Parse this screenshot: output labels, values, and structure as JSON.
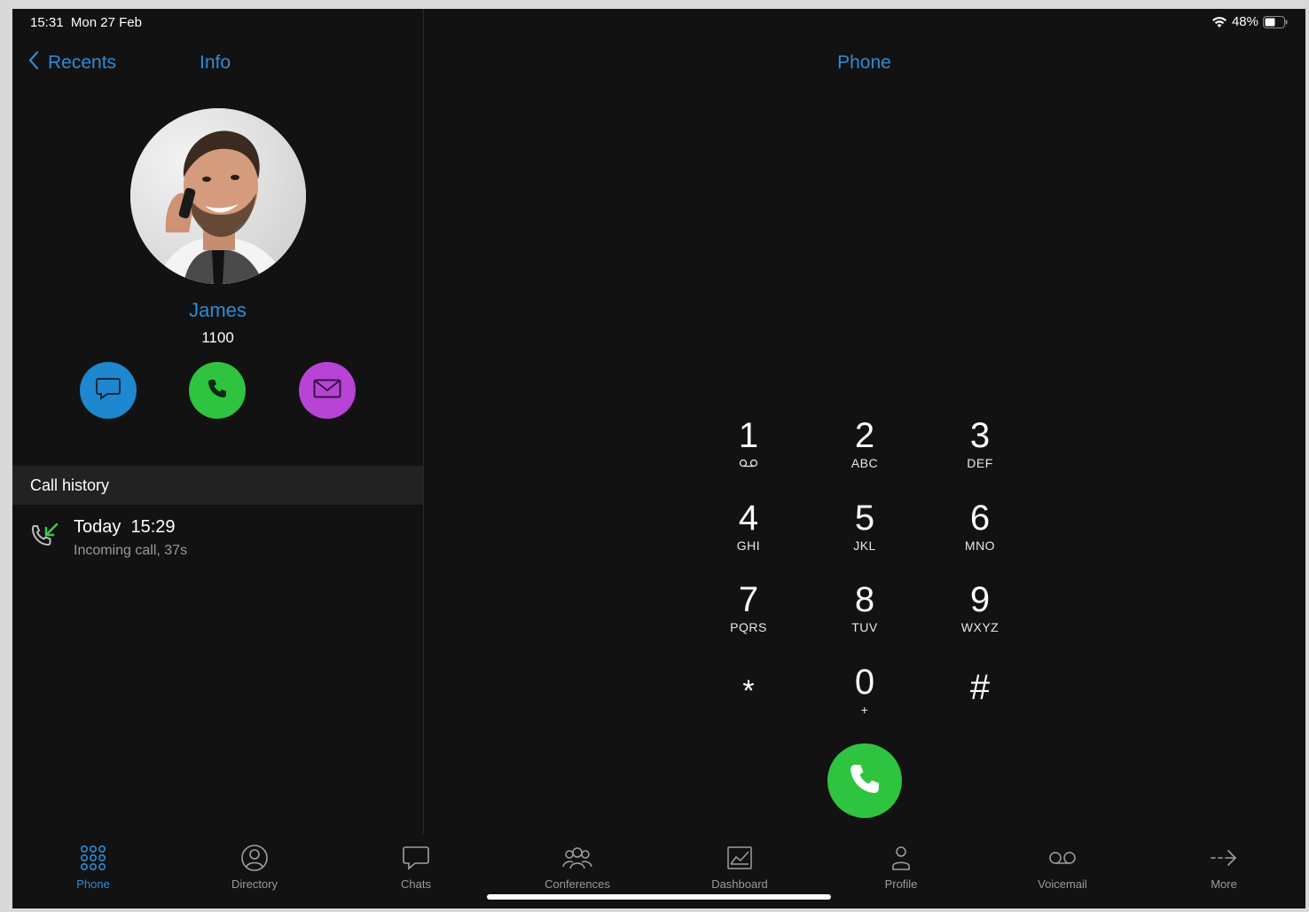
{
  "status_bar": {
    "time": "15:31",
    "date": "Mon 27 Feb",
    "battery": "48%"
  },
  "left_pane": {
    "back_label": "Recents",
    "title": "Info",
    "contact": {
      "name": "James",
      "number": "1100"
    },
    "actions": [
      {
        "name": "chat",
        "color": "#1f86d0"
      },
      {
        "name": "call",
        "color": "#2fc43f"
      },
      {
        "name": "email",
        "color": "#b844d6"
      }
    ],
    "call_history": {
      "header": "Call history",
      "items": [
        {
          "title": "Today  15:29",
          "subtitle": "Incoming call, 37s"
        }
      ]
    }
  },
  "dialpad": {
    "title": "Phone",
    "keys": [
      {
        "digit": "1",
        "letters": ""
      },
      {
        "digit": "2",
        "letters": "ABC"
      },
      {
        "digit": "3",
        "letters": "DEF"
      },
      {
        "digit": "4",
        "letters": "GHI"
      },
      {
        "digit": "5",
        "letters": "JKL"
      },
      {
        "digit": "6",
        "letters": "MNO"
      },
      {
        "digit": "7",
        "letters": "PQRS"
      },
      {
        "digit": "8",
        "letters": "TUV"
      },
      {
        "digit": "9",
        "letters": "WXYZ"
      },
      {
        "digit": "*",
        "letters": ""
      },
      {
        "digit": "0",
        "letters": "+"
      },
      {
        "digit": "#",
        "letters": ""
      }
    ]
  },
  "tab_bar": {
    "tabs": [
      {
        "label": "Phone",
        "icon": "dialpad-icon",
        "active": true
      },
      {
        "label": "Directory",
        "icon": "person-circle-icon"
      },
      {
        "label": "Chats",
        "icon": "chat-icon"
      },
      {
        "label": "Conferences",
        "icon": "group-icon"
      },
      {
        "label": "Dashboard",
        "icon": "chart-icon"
      },
      {
        "label": "Profile",
        "icon": "person-icon"
      },
      {
        "label": "Voicemail",
        "icon": "voicemail-icon"
      },
      {
        "label": "More",
        "icon": "arrow-right-icon"
      }
    ]
  },
  "colors": {
    "accent": "#2e8bd6",
    "background": "#121212",
    "call_green": "#2fc43f"
  }
}
